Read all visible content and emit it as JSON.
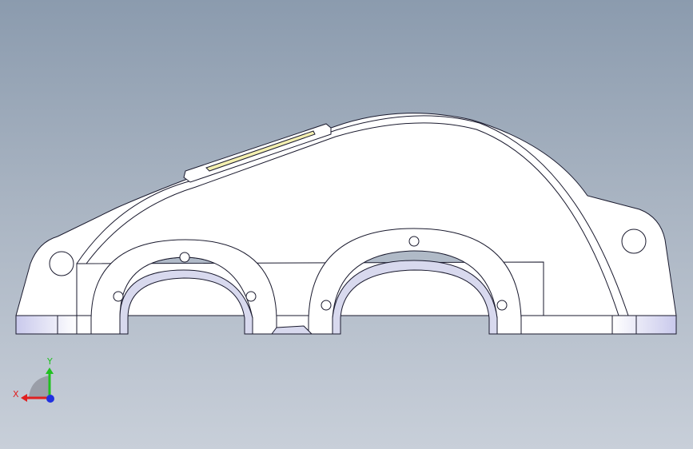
{
  "colors": {
    "background_top": "#8b9bae",
    "background_bottom": "#c8cfd9",
    "part_fill": "#ffffff",
    "part_edge": "#1a1a2e",
    "inner_surface": "#d8d9ee",
    "window_plate": "#f3efb0",
    "axis_x": "#e02020",
    "axis_y": "#20c020",
    "axis_z": "#2030e0"
  },
  "model": {
    "name": "gearbox-housing-side-view",
    "bores": 2,
    "bolt_holes_per_bore": 3,
    "lifting_lugs": 2
  },
  "triad": {
    "x_label": "X",
    "y_label": "Y"
  }
}
